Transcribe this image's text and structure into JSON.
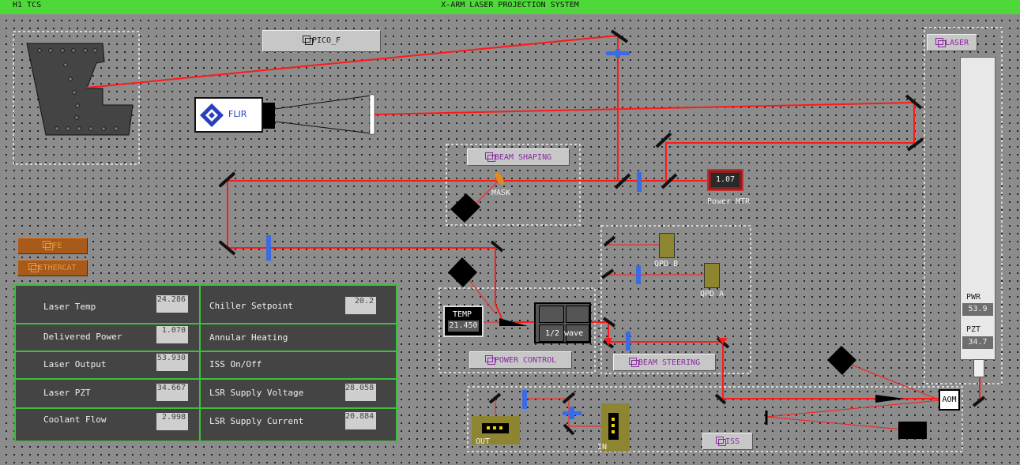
{
  "header": {
    "left_title": "H1 TCS",
    "center_title": "X-ARM LASER PROJECTION SYSTEM"
  },
  "buttons": {
    "pico_f": "PICO_F",
    "beam_shaping": "BEAM SHAPING",
    "laser": "LASER",
    "fe": "FE",
    "ethercat": "ETHERCAT",
    "power_control": "POWER CONTROL",
    "beam_steering": "BEAM STEERING",
    "iss": "ISS"
  },
  "components": {
    "flir": "FLIR",
    "mask": "MASK",
    "power_mtr_label": "Power MTR",
    "power_mtr_value": "1.07",
    "qpd_b": "QPD B",
    "qpd_a": "QPD A",
    "temp_label": "TEMP",
    "temp_value": "21.450",
    "half_wave": "1/2 wave",
    "aom": "AOM",
    "out": "OUT",
    "in": "IN"
  },
  "laser_panel": {
    "pwr_label": "PWR",
    "pwr_value": "53.9",
    "pzt_label": "PZT",
    "pzt_value": "34.7"
  },
  "status_table": {
    "left": [
      {
        "label": "Laser Temp",
        "value": "24.286"
      },
      {
        "label": "Delivered Power",
        "value": "1.070"
      },
      {
        "label": "Laser Output",
        "value": "53.930"
      },
      {
        "label": "Laser PZT",
        "value": "34.667"
      },
      {
        "label": "Coolant Flow",
        "value": "2.998"
      }
    ],
    "right": [
      {
        "label": "Chiller Setpoint",
        "value": "20.2"
      },
      {
        "label": "Annular Heating",
        "value": ""
      },
      {
        "label": "ISS On/Off",
        "value": ""
      },
      {
        "label": "LSR Supply Voltage",
        "value": "28.058"
      },
      {
        "label": "LSR Supply Current",
        "value": "20.884"
      }
    ]
  },
  "colors": {
    "beam": "#ff1a1a",
    "titlebar": "#4fd83a",
    "table_border": "#3cc03c"
  }
}
